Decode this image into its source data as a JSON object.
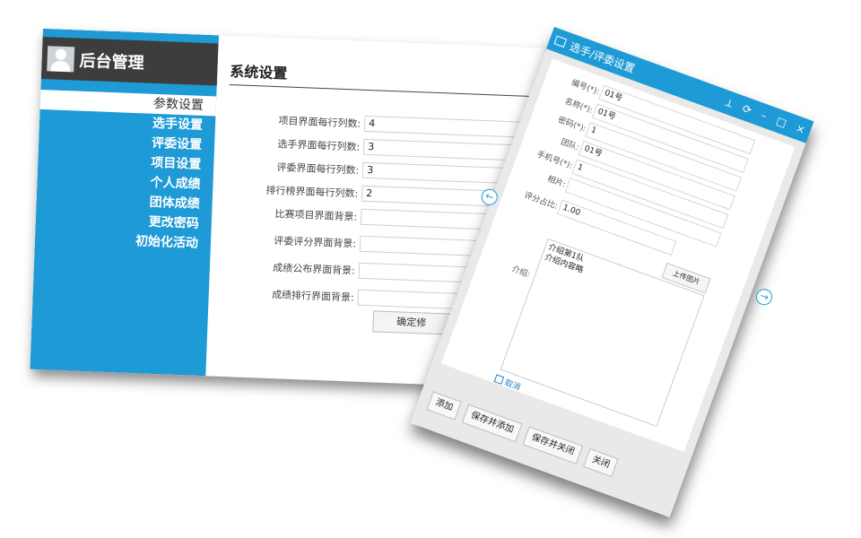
{
  "app": {
    "title": "后台管理"
  },
  "sidebar": {
    "items": [
      {
        "label": "参数设置"
      },
      {
        "label": "选手设置"
      },
      {
        "label": "评委设置"
      },
      {
        "label": "项目设置"
      },
      {
        "label": "个人成绩"
      },
      {
        "label": "团体成绩"
      },
      {
        "label": "更改密码"
      },
      {
        "label": "初始化活动"
      }
    ]
  },
  "settings": {
    "title": "系统设置",
    "fields": [
      {
        "label": "项目界面每行列数:",
        "value": "4"
      },
      {
        "label": "选手界面每行列数:",
        "value": "3"
      },
      {
        "label": "评委界面每行列数:",
        "value": "3"
      },
      {
        "label": "排行榜界面每行列数:",
        "value": "2"
      },
      {
        "label": "比赛项目界面背景:",
        "value": ""
      },
      {
        "label": "评委评分界面背景:",
        "value": ""
      },
      {
        "label": "成绩公布界面背景:",
        "value": ""
      },
      {
        "label": "成绩排行界面背景:",
        "value": ""
      }
    ],
    "confirm_label": "确定修"
  },
  "dialog": {
    "title": "选手/评委设置",
    "controls": {
      "pin": "⟂",
      "refresh": "⟳",
      "minimize": "–",
      "maximize": "□",
      "close": "×"
    },
    "fields": [
      {
        "label": "编号(*):",
        "value": "01号"
      },
      {
        "label": "名称(*):",
        "value": "01号"
      },
      {
        "label": "密码(*):",
        "value": "1"
      },
      {
        "label": "团队:",
        "value": "01号"
      },
      {
        "label": "手机号(*):",
        "value": "1"
      },
      {
        "label": "相片:",
        "value": ""
      },
      {
        "label": "评分占比:",
        "value": "1.00"
      }
    ],
    "upload_label": "上传图片",
    "intro_label": "介绍:",
    "intro_text": "介绍第1队\n介绍内容略",
    "cancel_label": "取消",
    "buttons": {
      "add": "添加",
      "save_add": "保存并添加",
      "save_close": "保存并关闭",
      "close": "关闭"
    },
    "prev_arrow": "←",
    "next_arrow": "→"
  },
  "colors": {
    "accent": "#1e9ad6",
    "header_dark": "#3d3d3d"
  }
}
